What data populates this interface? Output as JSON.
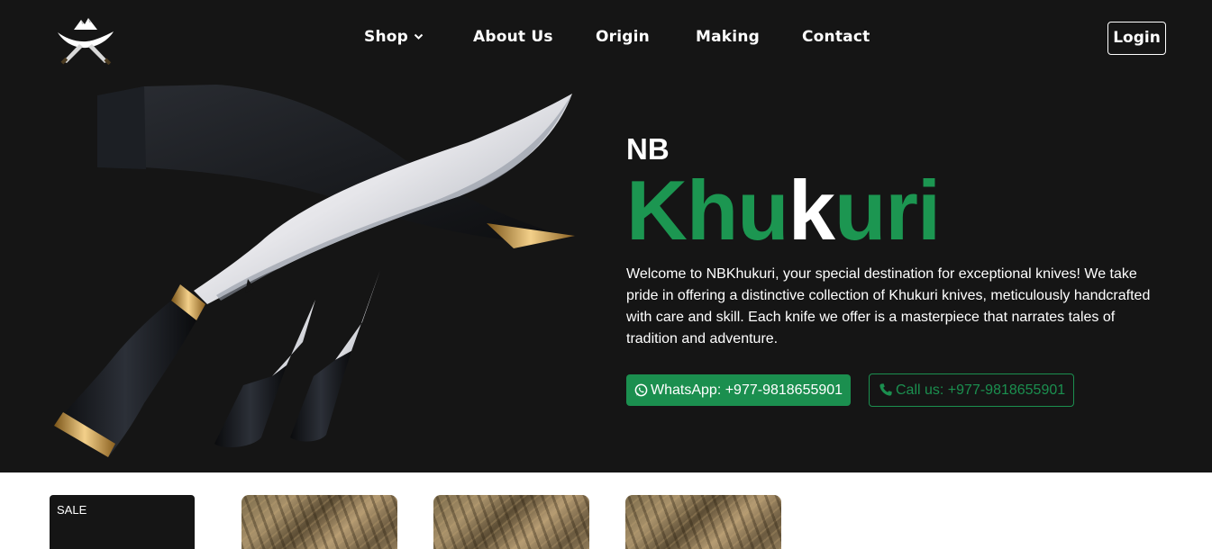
{
  "nav": {
    "items": [
      {
        "label": "Shop",
        "dropdown": true
      },
      {
        "label": "About Us"
      },
      {
        "label": "Origin"
      },
      {
        "label": "Making"
      },
      {
        "label": "Contact"
      }
    ],
    "login_label": "Login"
  },
  "hero": {
    "brand_prefix": "NB",
    "title_part1": "Khu",
    "title_part2": "k",
    "title_part3": "uri",
    "description": "Welcome to NBKhukuri, your special destination for exceptional knives! We take pride in offering a distinctive collection of Khukuri knives, meticulously handcrafted with care and skill. Each knife we offer is a masterpiece that narrates tales of tradition and adventure.",
    "whatsapp_label": "WhatsApp: +977-9818655901",
    "call_label": "Call us: +977-9818655901"
  },
  "products": {
    "sale_label": "SALE"
  },
  "colors": {
    "background": "#151515",
    "accent_green": "#1c9651",
    "text": "#ffffff"
  },
  "icons": {
    "logo": "crossed-khukuri-logo",
    "shop_dropdown": "chevron-down-icon",
    "whatsapp": "whatsapp-icon",
    "phone": "phone-icon"
  }
}
